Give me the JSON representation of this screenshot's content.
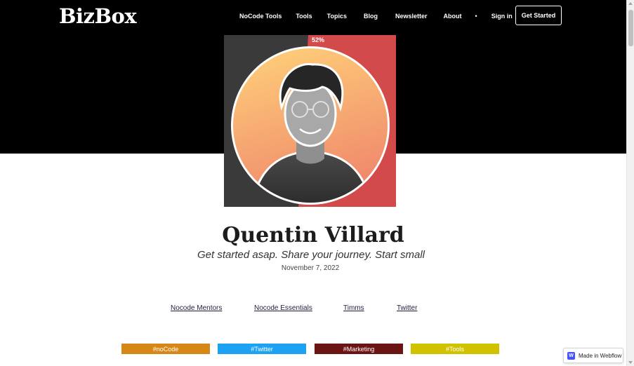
{
  "brand": {
    "name": "BizBox"
  },
  "nav": {
    "items": [
      "NoCode Tools",
      "Tools",
      "Topics",
      "Blog",
      "Newsletter",
      "About"
    ],
    "separator": "•",
    "signin_label": "Sign in",
    "cta_label": "Get Started"
  },
  "portrait": {
    "percent_badge": "52%",
    "colors": {
      "left_panel": "#3a3a3a",
      "right_panel": "#d34a4a",
      "circle_top": "#ffd27a",
      "circle_bottom": "#f08a6c"
    }
  },
  "author": {
    "name": "Quentin Villard",
    "tagline": "Get started asap. Share your journey. Start small",
    "date": "November 7, 2022"
  },
  "categories": [
    "Nocode Mentors",
    "Nocode Essentials",
    "Timms",
    "Twitter"
  ],
  "tags": [
    {
      "label": "#noCode",
      "color": "#d78716"
    },
    {
      "label": "#Twitter",
      "color": "#1da1f2"
    },
    {
      "label": "#Marketing",
      "color": "#6b1414"
    },
    {
      "label": "#Tools",
      "color": "#d1c200"
    }
  ],
  "webflow_badge": {
    "label": "Made in Webflow",
    "icon_letter": "W"
  }
}
